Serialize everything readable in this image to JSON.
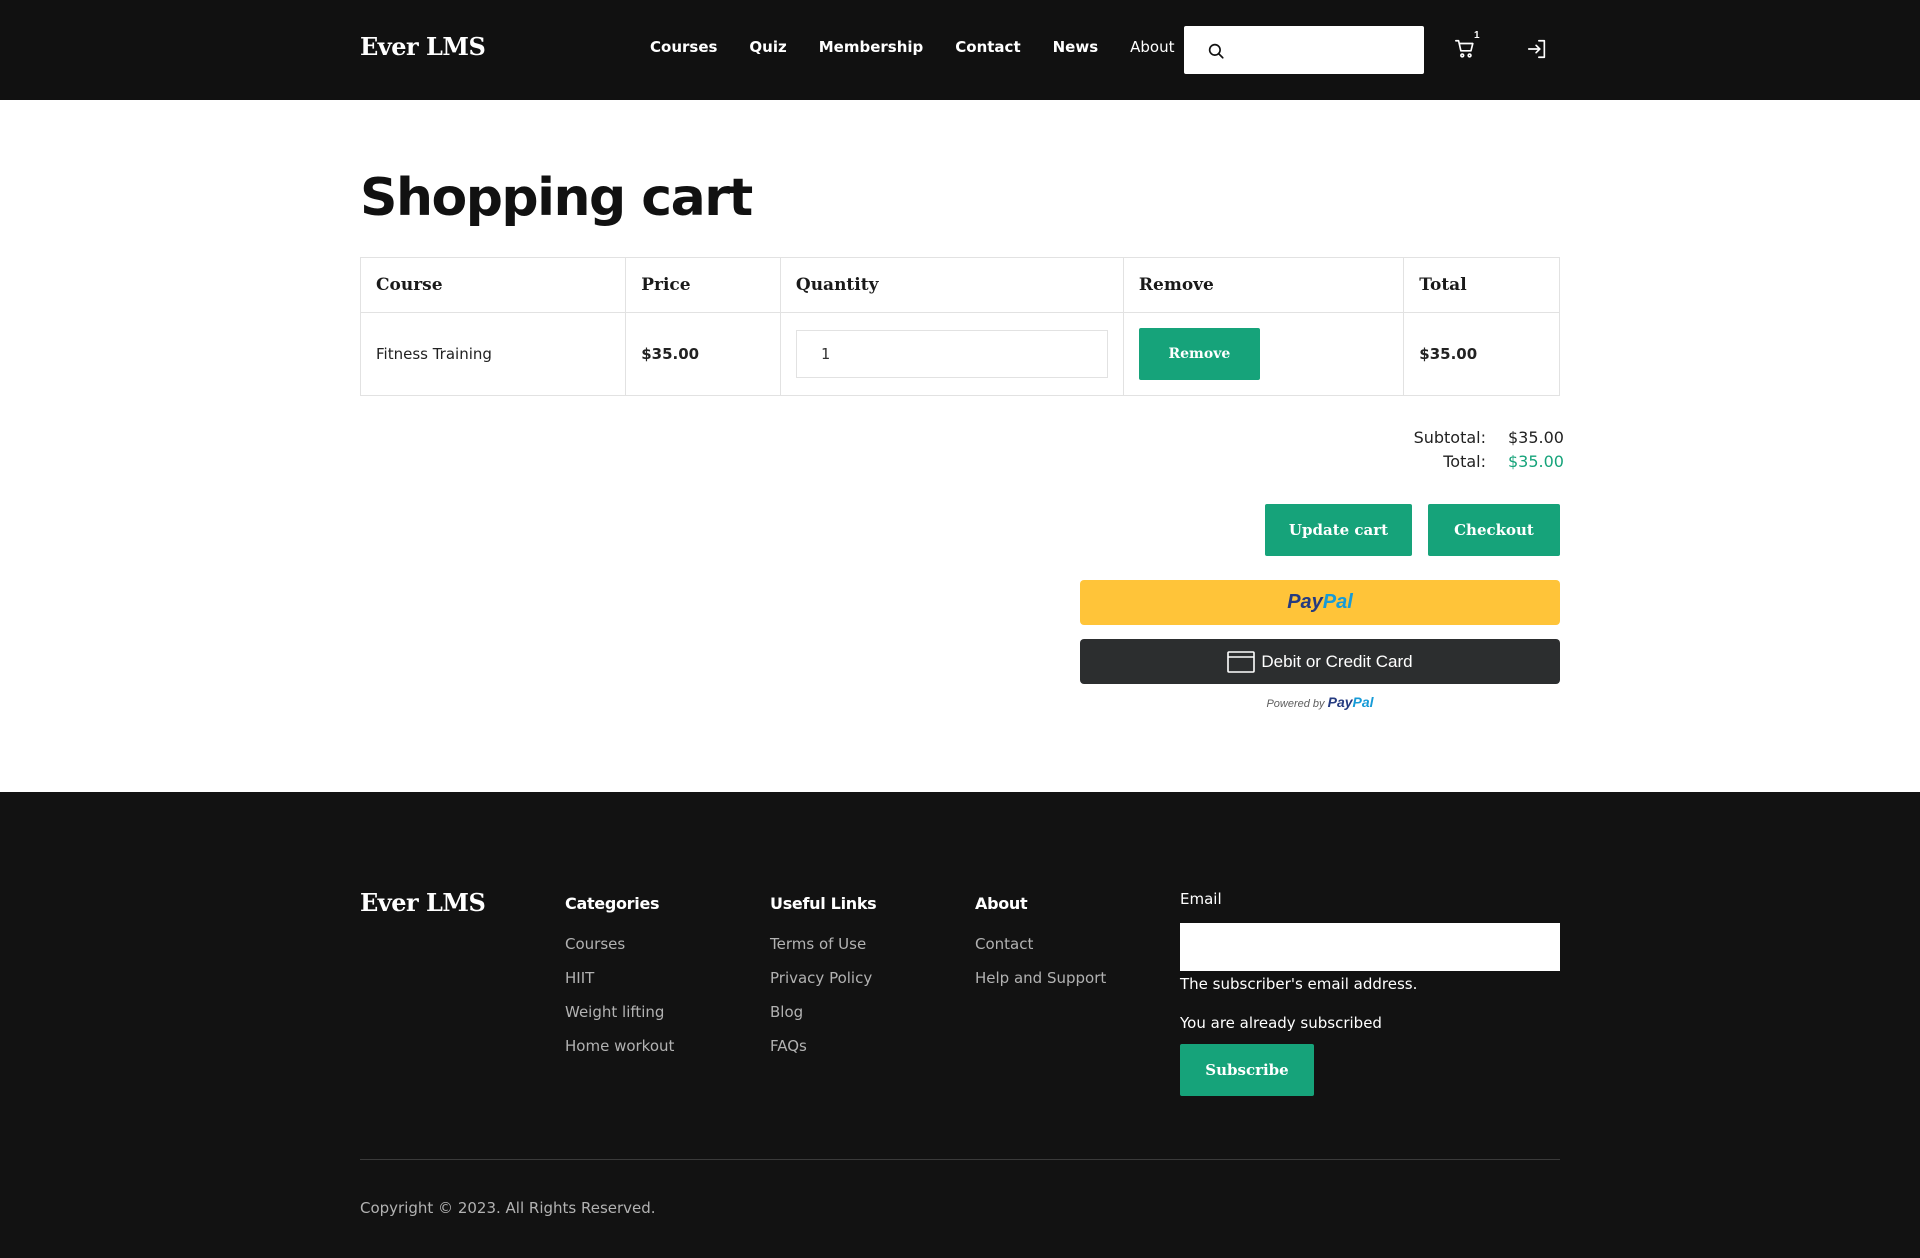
{
  "header": {
    "logo": "Ever LMS",
    "nav": [
      "Courses",
      "Quiz",
      "Membership",
      "Contact",
      "News"
    ],
    "about_label": "About",
    "search_placeholder": "",
    "cart_count": "1"
  },
  "main": {
    "title": "Shopping cart",
    "table": {
      "headers": [
        "Course",
        "Price",
        "Quantity",
        "Remove",
        "Total"
      ],
      "rows": [
        {
          "course": "Fitness Training",
          "price": "$35.00",
          "quantity": "1",
          "remove_label": "Remove",
          "total": "$35.00"
        }
      ]
    },
    "totals": {
      "subtotal_label": "Subtotal:",
      "subtotal": "$35.00",
      "total_label": "Total:",
      "total": "$35.00"
    },
    "update_label": "Update cart",
    "checkout_label": "Checkout",
    "paypal": {
      "brand_dark": "Pay",
      "brand_light": "Pal",
      "card_label": "Debit or Credit Card",
      "powered_by": "Powered by"
    }
  },
  "footer": {
    "logo": "Ever LMS",
    "columns": [
      {
        "title": "Categories",
        "links": [
          "Courses",
          "HIIT",
          "Weight lifting",
          "Home workout"
        ]
      },
      {
        "title": "Useful Links",
        "links": [
          "Terms of Use",
          "Privacy Policy",
          "Blog",
          "FAQs"
        ]
      },
      {
        "title": "About",
        "links": [
          "Contact",
          "Help and Support"
        ]
      }
    ],
    "email_label": "Email",
    "email_placeholder": "",
    "email_help": "The subscriber's email address.",
    "subscribe_status": "You are already subscribed",
    "subscribe_label": "Subscribe",
    "copyright": "Copyright © 2023. All Rights Reserved."
  },
  "colors": {
    "accent": "#16a37a",
    "dark": "#111111",
    "paypal_yellow": "#ffc439",
    "paypal_dark": "#2c2e2f"
  }
}
